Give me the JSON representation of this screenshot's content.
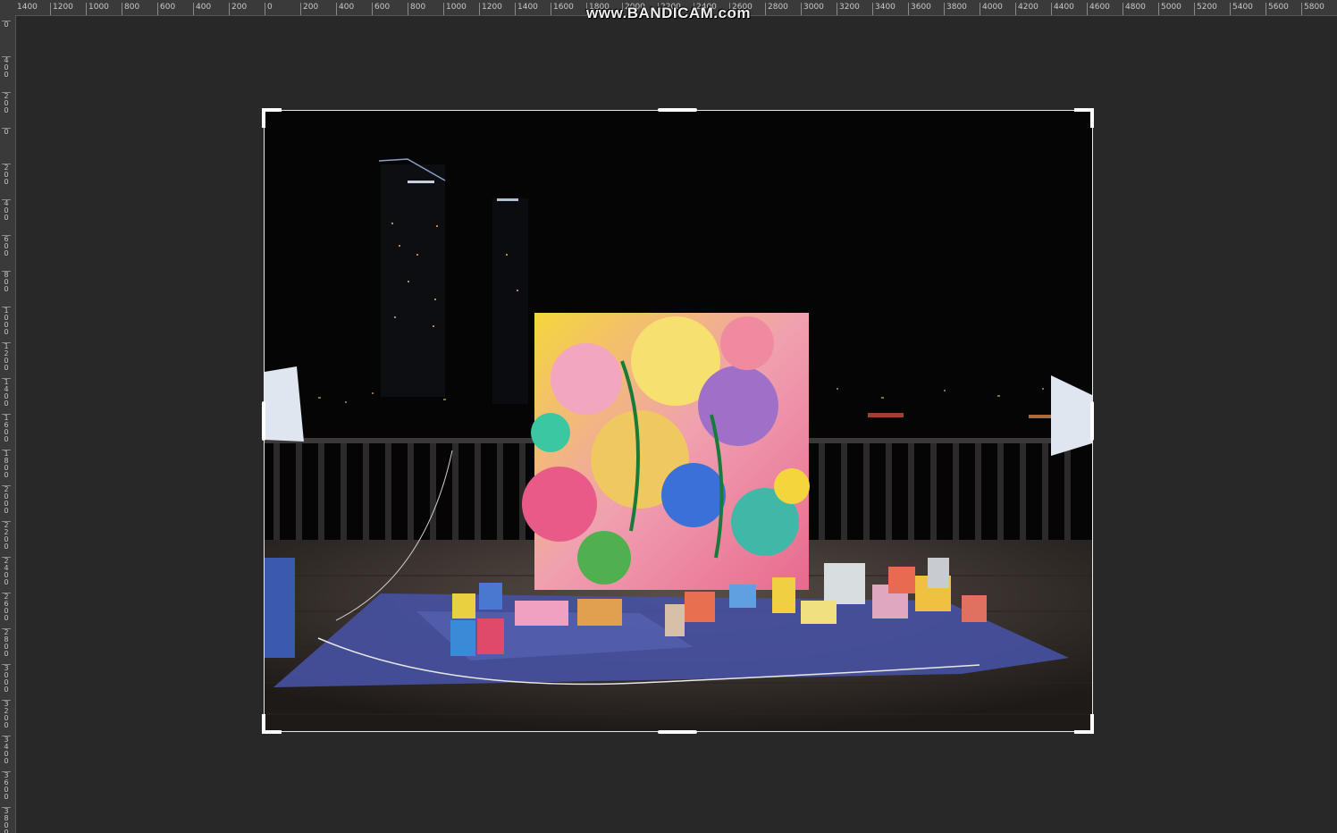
{
  "watermark": "www.BANDICAM.com",
  "ruler_top": {
    "labels": [
      "1400",
      "1200",
      "1000",
      "800",
      "600",
      "400",
      "200",
      "0",
      "200",
      "400",
      "600",
      "800",
      "1000",
      "1200",
      "1400",
      "1600",
      "1800",
      "2000",
      "2200",
      "2400",
      "2600",
      "2800",
      "3000",
      "3200",
      "3400",
      "3600",
      "3800",
      "4000",
      "4200",
      "4400",
      "4600",
      "4800",
      "5000",
      "5200",
      "5400",
      "5600",
      "5800"
    ]
  },
  "ruler_left": {
    "labels": [
      "0",
      "400",
      "200",
      "0",
      "200",
      "400",
      "600",
      "800",
      "1000",
      "1200",
      "1400",
      "1600",
      "1800",
      "2000",
      "2200",
      "2400",
      "2600",
      "2800",
      "3000",
      "3200",
      "3400",
      "3600",
      "3800"
    ]
  },
  "crop": {
    "tool": "crop",
    "handles": 8
  }
}
